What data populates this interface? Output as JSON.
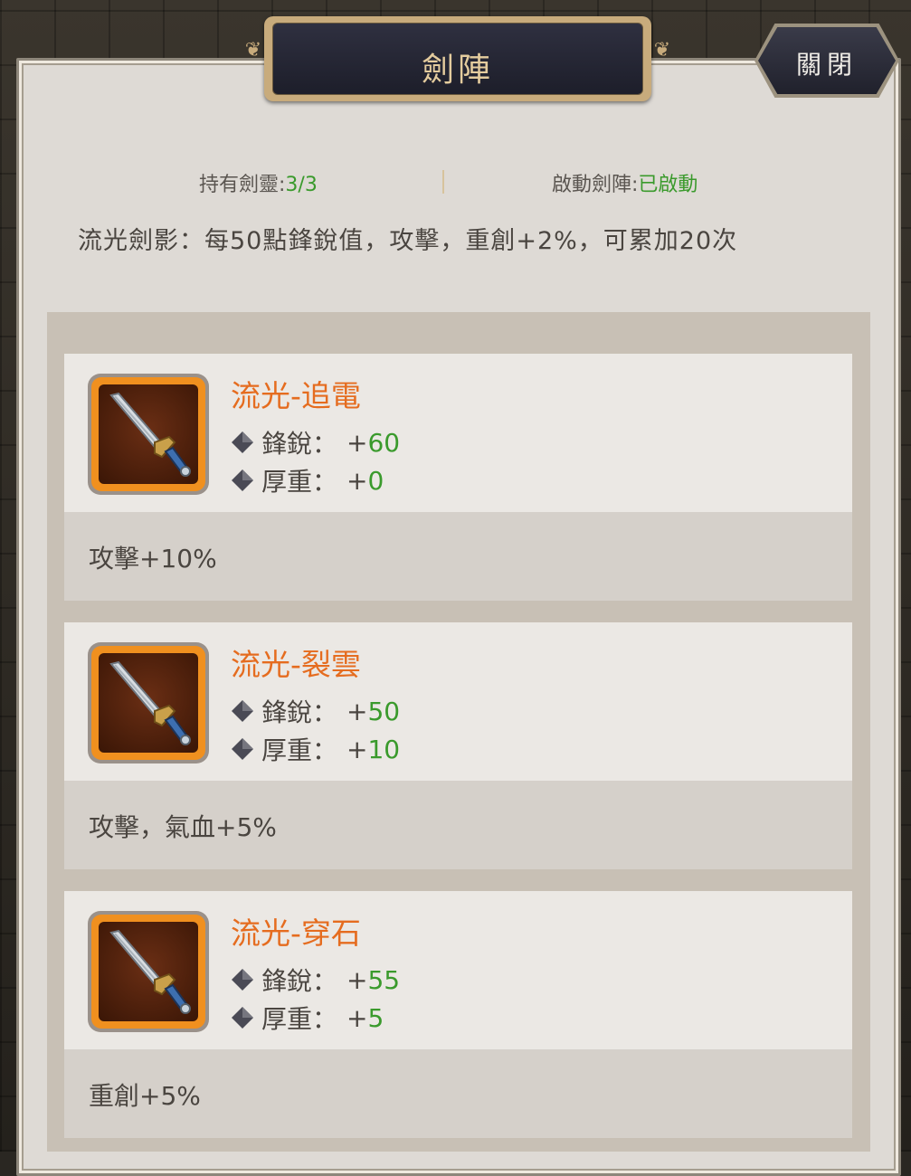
{
  "header": {
    "title": "劍陣",
    "close_label": "關閉"
  },
  "info": {
    "held_label": "持有劍靈:",
    "held_value": "3/3",
    "status_label": "啟動劍陣:",
    "status_value": "已啟動"
  },
  "description": "流光劍影：每50點鋒銳值，攻擊，重創+2%，可累加20次",
  "stat_labels": {
    "sharp": "鋒銳：",
    "heavy": "厚重："
  },
  "swords": [
    {
      "name": "流光-追電",
      "sharp": "60",
      "heavy": "0",
      "bonus": "攻擊+10%"
    },
    {
      "name": "流光-裂雲",
      "sharp": "50",
      "heavy": "10",
      "bonus": "攻擊，氣血+5%"
    },
    {
      "name": "流光-穿石",
      "sharp": "55",
      "heavy": "5",
      "bonus": "重創+5%"
    }
  ],
  "colors": {
    "name_orange": "#e56c1f",
    "value_green": "#3a9a2c",
    "title_gold": "#e4cc9e"
  },
  "icons": {
    "sword": "sword-icon",
    "diamond": "diamond-bullet-icon"
  }
}
